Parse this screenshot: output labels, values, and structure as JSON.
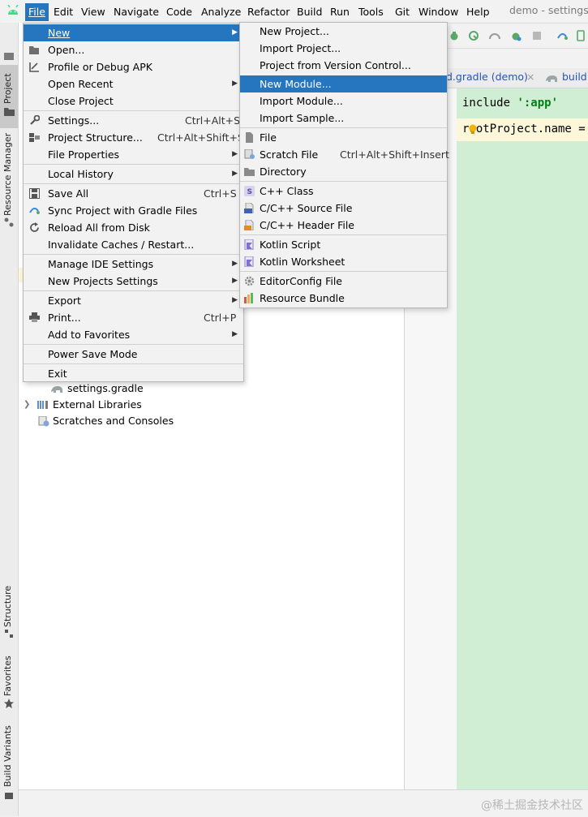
{
  "menubar": {
    "items": [
      {
        "label": "File"
      },
      {
        "label": "Edit"
      },
      {
        "label": "View"
      },
      {
        "label": "Navigate"
      },
      {
        "label": "Code"
      },
      {
        "label": "Analyze"
      },
      {
        "label": "Refactor"
      },
      {
        "label": "Build"
      },
      {
        "label": "Run"
      },
      {
        "label": "Tools"
      },
      {
        "label": "Git"
      },
      {
        "label": "Window"
      },
      {
        "label": "Help"
      }
    ],
    "window_title": "demo - settings.",
    "accent": "#2675bf"
  },
  "left_stripe": {
    "project_label": "Project",
    "resource_manager_label": "Resource Manager",
    "structure_label": "Structure",
    "favorites_label": "Favorites",
    "build_variants_label": "Build Variants"
  },
  "project_tree": {
    "rows": [
      {
        "label": "settings.gradle"
      },
      {
        "label": "External Libraries"
      },
      {
        "label": "Scratches and Consoles"
      }
    ]
  },
  "editor": {
    "tabs": [
      {
        "label": "d.gradle (demo)"
      },
      {
        "label": "build."
      }
    ],
    "line1_keyword": "include",
    "line1_string": "':app'",
    "line2": "rootProject.name ="
  },
  "file_menu": {
    "items": [
      {
        "label": "New",
        "shortcut": ""
      },
      {
        "label": "Open...",
        "shortcut": ""
      },
      {
        "label": "Profile or Debug APK",
        "shortcut": ""
      },
      {
        "label": "Open Recent",
        "shortcut": ""
      },
      {
        "label": "Close Project",
        "shortcut": ""
      },
      {
        "label": "Settings...",
        "shortcut": "Ctrl+Alt+S"
      },
      {
        "label": "Project Structure...",
        "shortcut": "Ctrl+Alt+Shift+S"
      },
      {
        "label": "File Properties",
        "shortcut": ""
      },
      {
        "label": "Local History",
        "shortcut": ""
      },
      {
        "label": "Save All",
        "shortcut": "Ctrl+S"
      },
      {
        "label": "Sync Project with Gradle Files",
        "shortcut": ""
      },
      {
        "label": "Reload All from Disk",
        "shortcut": ""
      },
      {
        "label": "Invalidate Caches / Restart...",
        "shortcut": ""
      },
      {
        "label": "Manage IDE Settings",
        "shortcut": ""
      },
      {
        "label": "New Projects Settings",
        "shortcut": ""
      },
      {
        "label": "Export",
        "shortcut": ""
      },
      {
        "label": "Print...",
        "shortcut": "Ctrl+P"
      },
      {
        "label": "Add to Favorites",
        "shortcut": ""
      },
      {
        "label": "Power Save Mode",
        "shortcut": ""
      },
      {
        "label": "Exit",
        "shortcut": ""
      }
    ]
  },
  "new_submenu": {
    "items": [
      {
        "label": "New Project..."
      },
      {
        "label": "Import Project..."
      },
      {
        "label": "Project from Version Control..."
      },
      {
        "label": "New Module..."
      },
      {
        "label": "Import Module..."
      },
      {
        "label": "Import Sample..."
      },
      {
        "label": "File"
      },
      {
        "label": "Scratch File",
        "shortcut": "Ctrl+Alt+Shift+Insert"
      },
      {
        "label": "Directory"
      },
      {
        "label": "C++ Class"
      },
      {
        "label": "C/C++ Source File"
      },
      {
        "label": "C/C++ Header File"
      },
      {
        "label": "Kotlin Script"
      },
      {
        "label": "Kotlin Worksheet"
      },
      {
        "label": "EditorConfig File"
      },
      {
        "label": "Resource Bundle"
      }
    ]
  },
  "watermark": "@稀土掘金技术社区"
}
